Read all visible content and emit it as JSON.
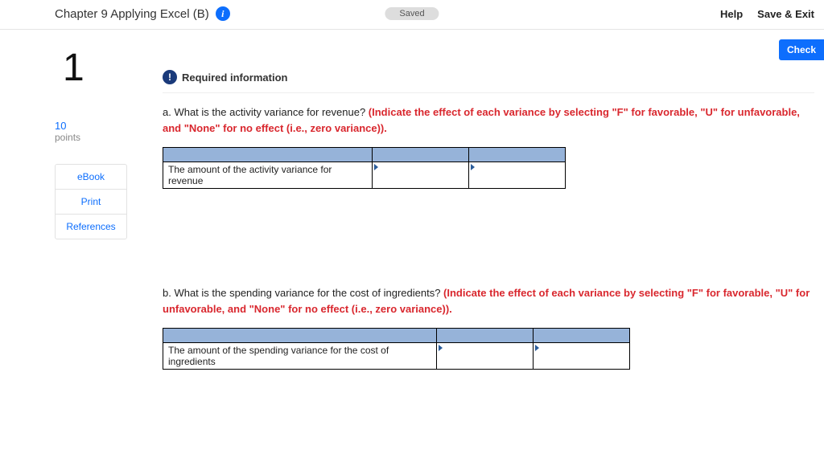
{
  "header": {
    "title": "Chapter 9 Applying Excel (B)",
    "saved": "Saved",
    "help": "Help",
    "saveExit": "Save & Exit"
  },
  "check": "Check",
  "question": {
    "number": "1",
    "pointsNum": "10",
    "pointsLabel": "points"
  },
  "sideLinks": {
    "ebook": "eBook",
    "print": "Print",
    "references": "References"
  },
  "required": "Required information",
  "qa": {
    "prefix": "a. What is the activity variance for revenue? ",
    "instr": "(Indicate the effect of each variance by selecting \"F\" for favorable, \"U\" for unfavorable, and \"None\" for no effect (i.e., zero variance)).",
    "rowLabel": "The amount of the activity variance for revenue"
  },
  "qb": {
    "prefix": "b. What is the spending variance for the cost of ingredients? ",
    "instr": "(Indicate the effect of each variance by selecting \"F\" for favorable, \"U\" for unfavorable, and \"None\" for no effect (i.e., zero variance)).",
    "rowLabel": "The amount of the spending variance for the cost of ingredients"
  }
}
